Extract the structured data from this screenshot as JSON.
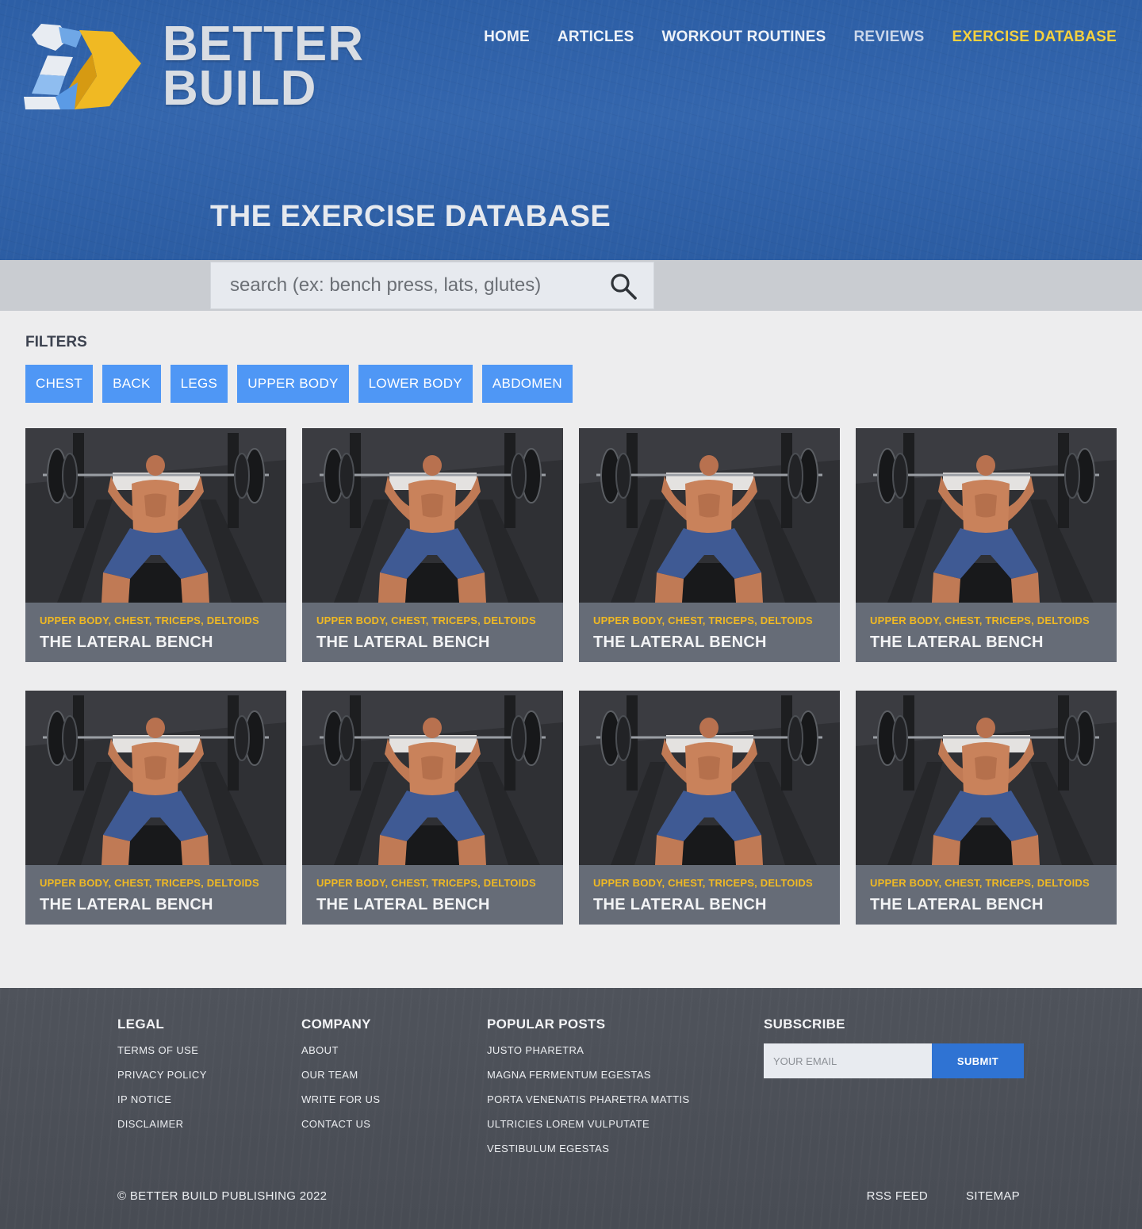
{
  "brand": {
    "line1": "BETTER",
    "line2": "BUILD",
    "colors": {
      "blue": "#3466ad",
      "yellow": "#f0b923",
      "light": "#d9dde3"
    }
  },
  "nav": {
    "items": [
      {
        "label": "HOME",
        "state": "normal"
      },
      {
        "label": "ARTICLES",
        "state": "normal"
      },
      {
        "label": "WORKOUT ROUTINES",
        "state": "normal"
      },
      {
        "label": "REVIEWS",
        "state": "dim"
      },
      {
        "label": "EXERCISE DATABASE",
        "state": "active"
      }
    ],
    "active_color": "#f4d03f"
  },
  "page_title": "THE EXERCISE DATABASE",
  "search": {
    "placeholder": "search (ex: bench press, lats, glutes)",
    "value": "",
    "icon": "search-icon"
  },
  "filters": {
    "title": "FILTERS",
    "items": [
      "CHEST",
      "BACK",
      "LEGS",
      "UPPER BODY",
      "LOWER BODY",
      "ABDOMEN"
    ],
    "color": "#4f97f5"
  },
  "cards": [
    {
      "tags": "UPPER BODY, CHEST, TRICEPS, DELTOIDS",
      "title": "THE LATERAL BENCH",
      "image": "bench-press-photo"
    },
    {
      "tags": "UPPER BODY, CHEST, TRICEPS, DELTOIDS",
      "title": "THE LATERAL BENCH",
      "image": "bench-press-photo"
    },
    {
      "tags": "UPPER BODY, CHEST, TRICEPS, DELTOIDS",
      "title": "THE LATERAL BENCH",
      "image": "bench-press-photo"
    },
    {
      "tags": "UPPER BODY, CHEST, TRICEPS, DELTOIDS",
      "title": "THE LATERAL BENCH",
      "image": "bench-press-photo"
    },
    {
      "tags": "UPPER BODY, CHEST, TRICEPS, DELTOIDS",
      "title": "THE LATERAL BENCH",
      "image": "bench-press-photo"
    },
    {
      "tags": "UPPER BODY, CHEST, TRICEPS, DELTOIDS",
      "title": "THE LATERAL BENCH",
      "image": "bench-press-photo"
    },
    {
      "tags": "UPPER BODY, CHEST, TRICEPS, DELTOIDS",
      "title": "THE LATERAL BENCH",
      "image": "bench-press-photo"
    },
    {
      "tags": "UPPER BODY, CHEST, TRICEPS, DELTOIDS",
      "title": "THE LATERAL BENCH",
      "image": "bench-press-photo"
    }
  ],
  "footer": {
    "legal": {
      "title": "LEGAL",
      "links": [
        "TERMS OF USE",
        "PRIVACY POLICY",
        "IP NOTICE",
        "DISCLAIMER"
      ]
    },
    "company": {
      "title": "COMPANY",
      "links": [
        "ABOUT",
        "OUR TEAM",
        "WRITE FOR US",
        "CONTACT US"
      ]
    },
    "popular": {
      "title": "POPULAR POSTS",
      "links": [
        "JUSTO PHARETRA",
        "MAGNA FERMENTUM EGESTAS",
        "PORTA VENENATIS PHARETRA MATTIS",
        "ULTRICIES LOREM VULPUTATE",
        "VESTIBULUM EGESTAS"
      ]
    },
    "subscribe": {
      "title": "SUBSCRIBE",
      "placeholder": "YOUR EMAIL",
      "button": "SUBMIT",
      "button_color": "#2f73d3"
    },
    "copyright": "© BETTER BUILD PUBLISHING 2022",
    "bottom_links": [
      "RSS FEED",
      "SITEMAP"
    ]
  }
}
